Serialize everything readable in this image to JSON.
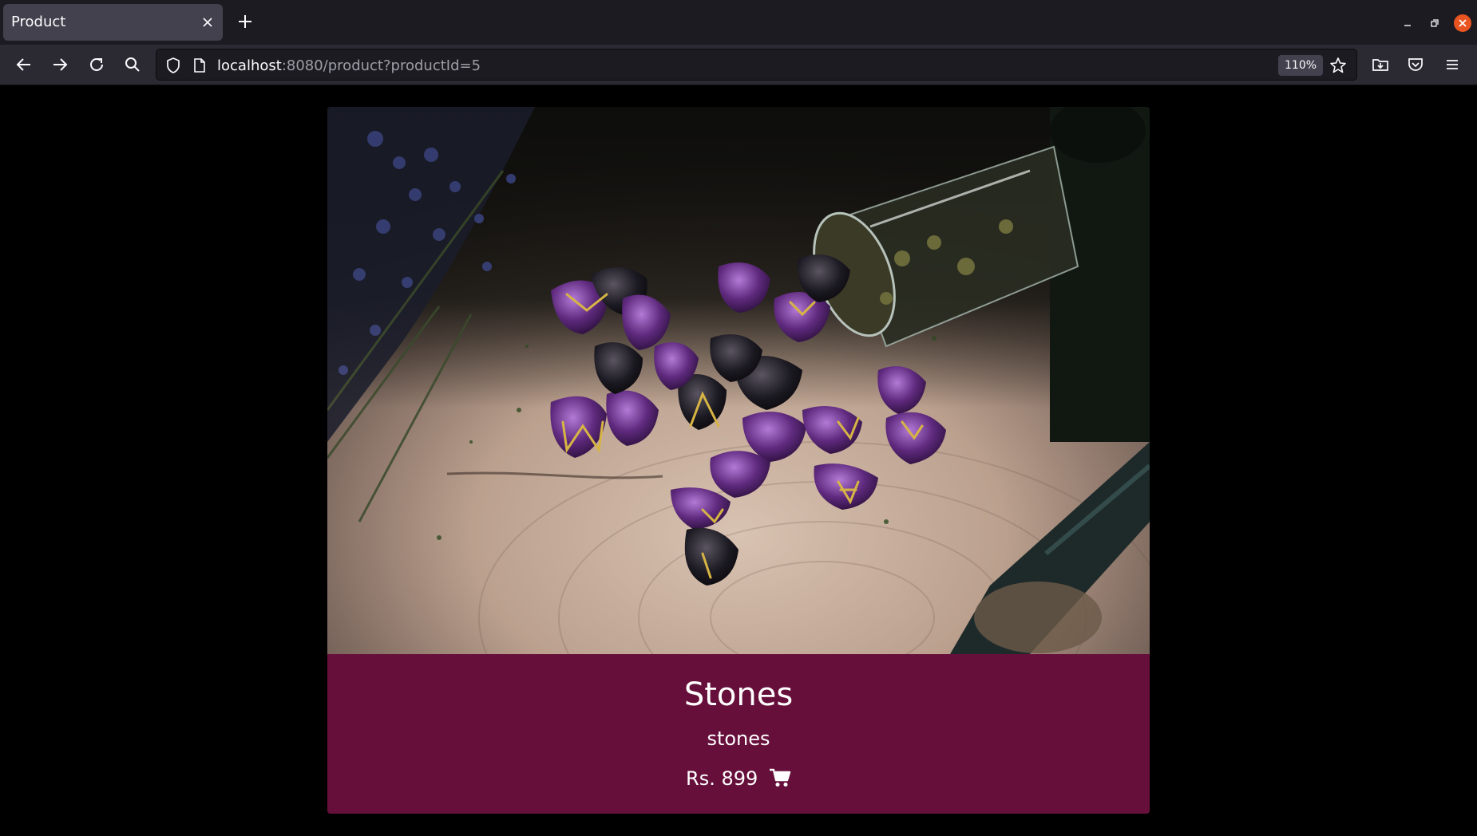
{
  "browser": {
    "tab_title": "Product",
    "url_host": "localhost",
    "url_rest": ":8080/product?productId=5",
    "zoom": "110%"
  },
  "product": {
    "name": "Stones",
    "description": "stones",
    "price": "Rs. 899",
    "image_alt": "stones"
  },
  "colors": {
    "card_background": "#670f3b",
    "page_background": "#000000",
    "chrome_tabbar": "#1c1b22",
    "chrome_navbar": "#2b2a33"
  },
  "icons": {
    "cart": "shopping-cart-icon"
  }
}
